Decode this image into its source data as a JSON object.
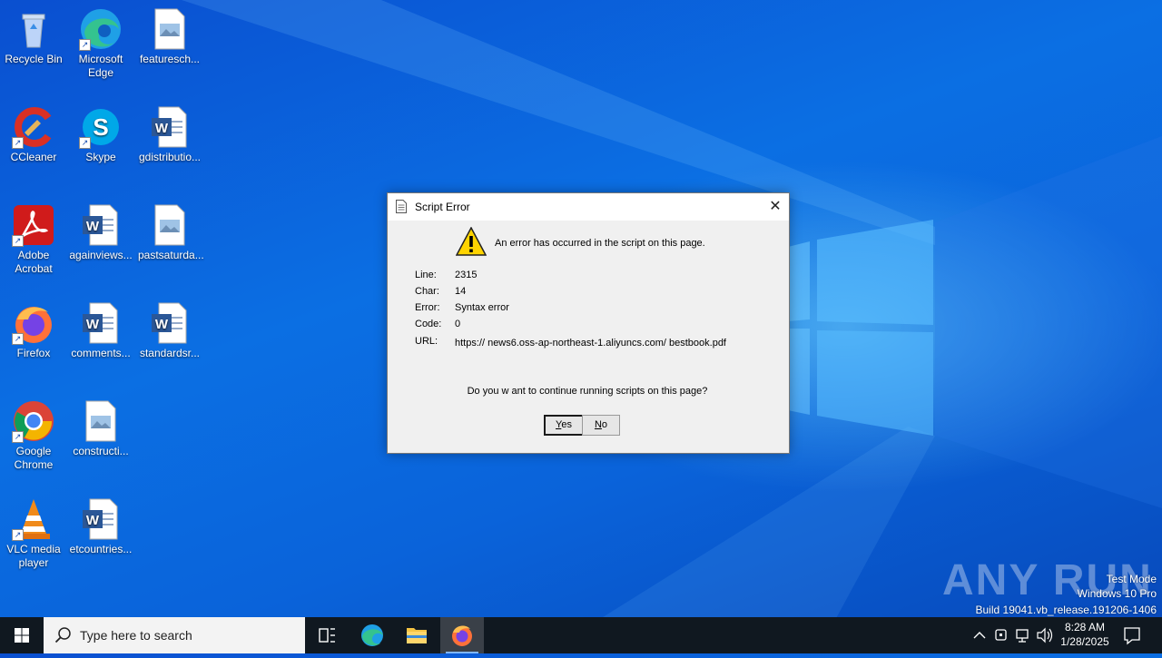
{
  "desktop": {
    "icons": [
      {
        "label": "Recycle Bin"
      },
      {
        "label": "Microsoft Edge"
      },
      {
        "label": "featuresch..."
      },
      {
        "label": "CCleaner"
      },
      {
        "label": "Skype"
      },
      {
        "label": "gdistributio..."
      },
      {
        "label": "Adobe Acrobat"
      },
      {
        "label": "againviews..."
      },
      {
        "label": "pastsaturda..."
      },
      {
        "label": "Firefox"
      },
      {
        "label": "comments..."
      },
      {
        "label": "standardsr..."
      },
      {
        "label": "Google Chrome"
      },
      {
        "label": "constructi..."
      },
      {
        "label": "VLC media player"
      },
      {
        "label": "etcountries..."
      }
    ]
  },
  "dialog": {
    "title": "Script Error",
    "message": "An error has occurred in the script on this page.",
    "fields": [
      {
        "key": "Line:",
        "value": "2315"
      },
      {
        "key": "Char:",
        "value": "14"
      },
      {
        "key": "Error:",
        "value": "Syntax error"
      },
      {
        "key": "Code:",
        "value": "0"
      },
      {
        "key": "URL:",
        "value": "https:// news6.oss-ap-northeast-1.aliyuncs.com/ bestbook.pdf"
      }
    ],
    "question": "Do you w ant to continue running scripts on this page?",
    "yes_label": "Yes",
    "no_label": "No",
    "close_glyph": "✕"
  },
  "taskbar": {
    "search_placeholder": "Type here to search",
    "time": "8:28 AM",
    "date": "1/28/2025"
  },
  "watermark": {
    "mode": "Test Mode",
    "edition": "Windows 10 Pro",
    "build": "Build 19041.vb_release.191206-1406",
    "brand": "ANY RUN"
  },
  "colors": {
    "desktop_blue": "#0b6fe3",
    "taskbar": "#101820",
    "dialog_bg": "#f0f0f0"
  }
}
